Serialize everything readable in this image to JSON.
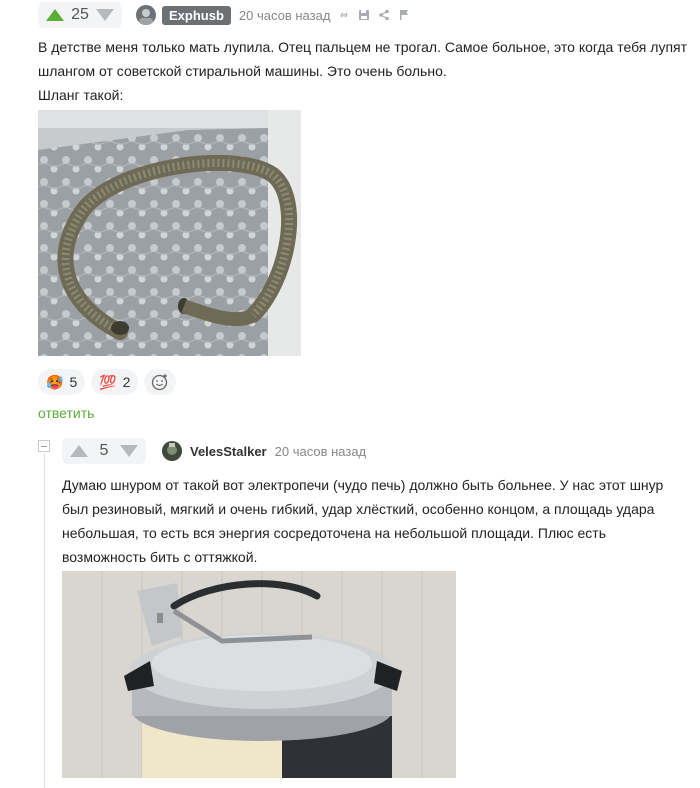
{
  "comment1": {
    "votes": "25",
    "author": "Exphusb",
    "time": "20 часов назад",
    "text_line1": "В детстве меня только мать лупила. Отец пальцем не трогал. Самое больное, это когда тебя лупят",
    "text_line2": "шлангом от советской стиральной машины. Это очень больно.",
    "text_line3": "Шланг такой:",
    "image_alt": "hose photo",
    "reactions": [
      {
        "emoji": "🥵",
        "count": "5"
      },
      {
        "emoji": "💯",
        "count": "2"
      }
    ],
    "reply_label": "ответить"
  },
  "comment2": {
    "votes": "5",
    "author": "VelesStalker",
    "time": "20 часов назад",
    "text_line1": "Думаю шнуром от такой вот электропечи (чудо печь) должно быть больнее. У нас этот шнур",
    "text_line2": "был резиновый, мягкий и очень гибкий, удар хлёсткий, особенно концом, а площадь удара",
    "text_line3": "небольшая, то есть вся энергия сосредоточена на небольшой площади. Плюс есть",
    "text_line4": "возможность бить с оттяжкой.",
    "image_alt": "electric oven photo"
  },
  "colors": {
    "accent_green": "#5cad3a",
    "badge_grey": "#6b7075",
    "muted": "#888888"
  }
}
